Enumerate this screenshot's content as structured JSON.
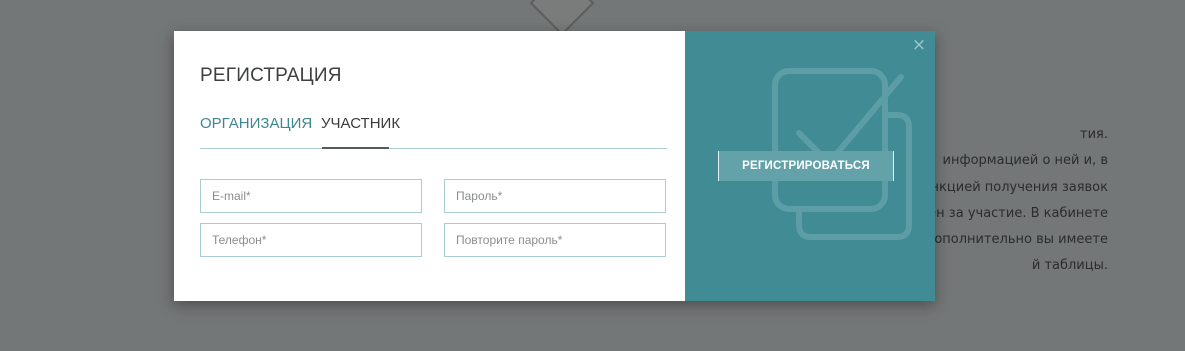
{
  "background": {
    "text_lines": [
      "тия.",
      "информацией о ней и, в",
      "функцией получения заявок",
      "ден за участие. В кабинете",
      "е. Дополнительно вы имеете",
      "й таблицы."
    ]
  },
  "modal": {
    "title": "РЕГИСТРАЦИЯ",
    "tabs": [
      {
        "label": "ОРГАНИЗАЦИЯ",
        "active": false
      },
      {
        "label": "УЧАСТНИК",
        "active": true
      }
    ],
    "fields": {
      "email_placeholder": "E-mail*",
      "password_placeholder": "Пароль*",
      "phone_placeholder": "Телефон*",
      "repeat_password_placeholder": "Повторите пароль*"
    },
    "register_button": "РЕГИСТРИРОВАТЬСЯ",
    "close_icon": "×",
    "colors": {
      "accent": "#418b94",
      "tab_active_text": "#3a3c3d",
      "tab_inactive_text": "#3f8691",
      "field_border": "#a9cdd1",
      "overlay": "#747777"
    }
  }
}
